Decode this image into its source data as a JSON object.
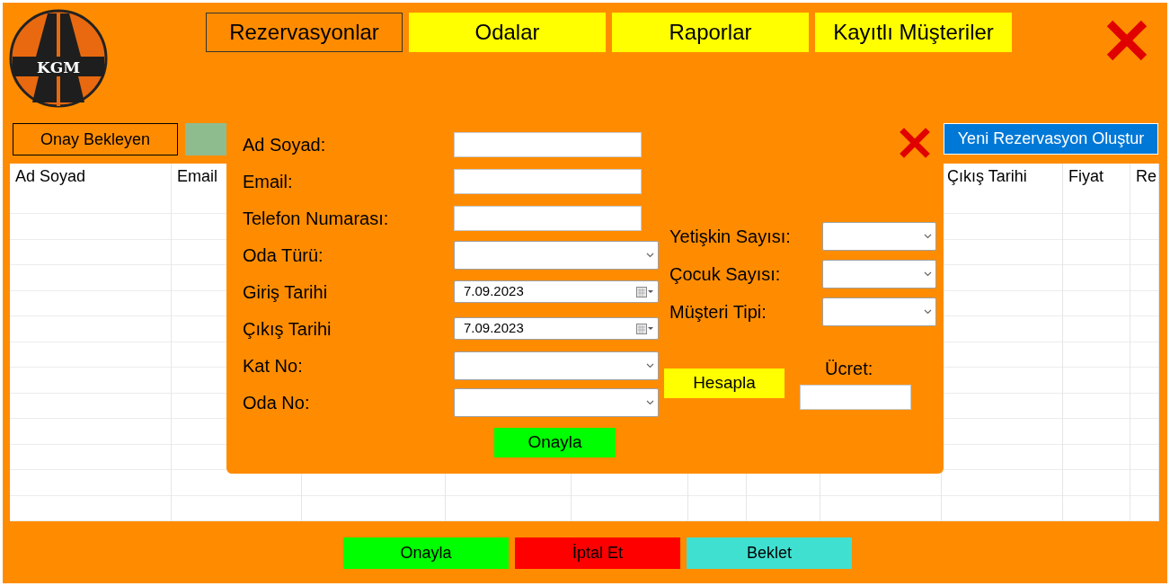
{
  "logo": {
    "text": "KGM"
  },
  "tabs": [
    {
      "label": "Rezervasyonlar",
      "selected": true
    },
    {
      "label": "Odalar",
      "selected": false
    },
    {
      "label": "Raporlar",
      "selected": false
    },
    {
      "label": "Kayıtlı Müşteriler",
      "selected": false
    }
  ],
  "filters": [
    {
      "label": "Onay Bekleyen",
      "selected": true
    },
    {
      "selected": false
    }
  ],
  "new_button": "Yeni Rezervasyon Oluştur",
  "table": {
    "left_columns": [
      "Ad Soyad",
      "Email"
    ],
    "right_columns": [
      "Çıkış Tarihi",
      "Fiyat",
      "Re"
    ]
  },
  "dialog": {
    "left_fields": [
      {
        "label": "Ad Soyad:",
        "kind": "text"
      },
      {
        "label": "Email:",
        "kind": "text"
      },
      {
        "label": "Telefon Numarası:",
        "kind": "text"
      },
      {
        "label": "Oda Türü:",
        "kind": "select"
      },
      {
        "label": "Giriş Tarihi",
        "kind": "date",
        "value": "7.09.2023"
      },
      {
        "label": "Çıkış Tarihi",
        "kind": "date",
        "value": "7.09.2023"
      },
      {
        "label": "Kat No:",
        "kind": "select"
      },
      {
        "label": "Oda No:",
        "kind": "select"
      }
    ],
    "right_fields": [
      {
        "label": "Yetişkin Sayısı:",
        "kind": "select"
      },
      {
        "label": "Çocuk Sayısı:",
        "kind": "select"
      },
      {
        "label": "Müşteri Tipi:",
        "kind": "select"
      }
    ],
    "calculate_button": "Hesapla",
    "price_label": "Ücret:",
    "submit_button": "Onayla"
  },
  "actions": [
    {
      "label": "Onayla",
      "color": "#00ff00"
    },
    {
      "label": "İptal Et",
      "color": "#ff0000"
    },
    {
      "label": "Beklet",
      "color": "#40e0d0"
    }
  ]
}
